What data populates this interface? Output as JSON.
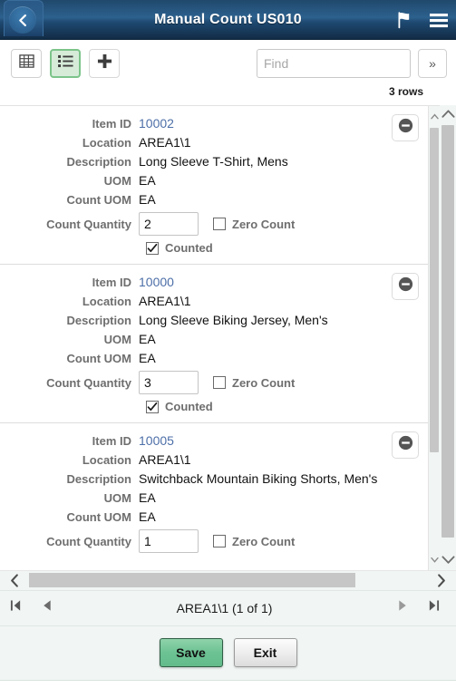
{
  "header": {
    "title": "Manual Count US010",
    "back_icon": "chevron-left-icon",
    "flag_icon": "flag-icon",
    "menu_icon": "hamburger-menu-icon"
  },
  "toolbar": {
    "grid_view_icon": "grid-view-icon",
    "list_view_icon": "list-view-icon",
    "add_icon": "plus-icon",
    "find_value": "",
    "find_placeholder": "Find",
    "find_more_label": "»"
  },
  "grid": {
    "rows_count_label": "3 rows",
    "labels": {
      "item_id": "Item ID",
      "location": "Location",
      "description": "Description",
      "uom": "UOM",
      "count_uom": "Count UOM",
      "count_quantity": "Count Quantity",
      "zero_count": "Zero Count",
      "counted": "Counted"
    },
    "rows": [
      {
        "item_id": "10002",
        "location": "AREA1\\1",
        "description": "Long Sleeve T-Shirt, Mens",
        "uom": "EA",
        "count_uom": "EA",
        "count_quantity": "2",
        "zero_count_checked": false,
        "counted_checked": true,
        "show_counted": true,
        "delete_icon": "minus-circle-icon"
      },
      {
        "item_id": "10000",
        "location": "AREA1\\1",
        "description": "Long Sleeve Biking Jersey, Men's",
        "uom": "EA",
        "count_uom": "EA",
        "count_quantity": "3",
        "zero_count_checked": false,
        "counted_checked": true,
        "show_counted": true,
        "delete_icon": "minus-circle-icon"
      },
      {
        "item_id": "10005",
        "location": "AREA1\\1",
        "description": "Switchback Mountain Biking Shorts, Men's",
        "uom": "EA",
        "count_uom": "EA",
        "count_quantity": "1",
        "zero_count_checked": false,
        "counted_checked": true,
        "show_counted": false,
        "delete_icon": "minus-circle-icon"
      }
    ]
  },
  "pager": {
    "first_icon": "first-page-icon",
    "prev_icon": "previous-page-icon",
    "label": "AREA1\\1 (1 of 1)",
    "next_icon": "next-page-icon",
    "last_icon": "last-page-icon"
  },
  "footer": {
    "save_label": "Save",
    "exit_label": "Exit"
  },
  "colors": {
    "header_blue": "#2d618e",
    "accent_green": "#6cc293",
    "link_blue": "#4d6fa8",
    "label_gray": "#6e6e6e",
    "panel_bg": "#f1f6f4"
  }
}
